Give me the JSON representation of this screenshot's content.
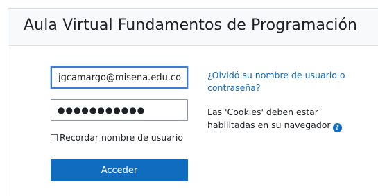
{
  "header": {
    "title": "Aula Virtual Fundamentos de Programación"
  },
  "login": {
    "username_value": "jgcamargo@misena.edu.co",
    "password_masked": "●●●●●●●●●●●",
    "remember_label": "Recordar nombre de usuario",
    "submit_label": "Acceder"
  },
  "help": {
    "forgot_link": "¿Olvidó su nombre de usuario o contraseña?",
    "cookies_text": "Las 'Cookies' deben estar habilitadas en su navegador",
    "help_icon_glyph": "?"
  },
  "colors": {
    "accent": "#0f6cbf",
    "focus_border": "#3a7bd5"
  }
}
